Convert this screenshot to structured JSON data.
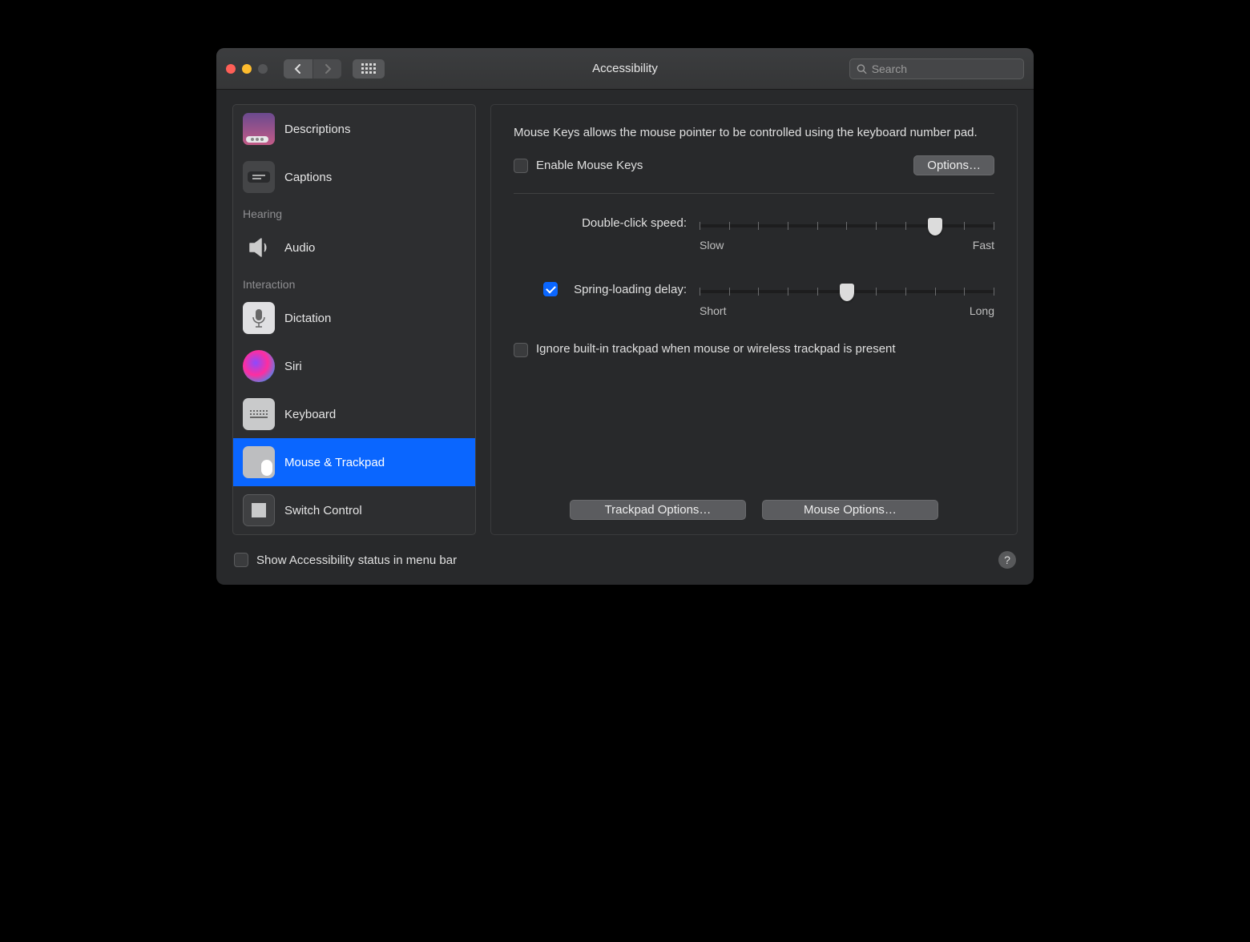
{
  "window": {
    "title": "Accessibility"
  },
  "search": {
    "placeholder": "Search"
  },
  "sidebar": {
    "items": [
      {
        "label": "Descriptions"
      },
      {
        "label": "Captions"
      }
    ],
    "hearing_header": "Hearing",
    "hearing_items": [
      {
        "label": "Audio"
      }
    ],
    "interaction_header": "Interaction",
    "interaction_items": [
      {
        "label": "Dictation"
      },
      {
        "label": "Siri"
      },
      {
        "label": "Keyboard"
      },
      {
        "label": "Mouse & Trackpad"
      },
      {
        "label": "Switch Control"
      }
    ]
  },
  "panel": {
    "intro": "Mouse Keys allows the mouse pointer to be controlled using the keyboard number pad.",
    "enable_mouse_keys_label": "Enable Mouse Keys",
    "options_btn": "Options…",
    "double_click_label": "Double-click speed:",
    "double_click_slow": "Slow",
    "double_click_fast": "Fast",
    "spring_loading_label": "Spring-loading delay:",
    "spring_loading_short": "Short",
    "spring_loading_long": "Long",
    "ignore_trackpad_label": "Ignore built-in trackpad when mouse or wireless trackpad is present",
    "trackpad_options_btn": "Trackpad Options…",
    "mouse_options_btn": "Mouse Options…"
  },
  "footer": {
    "show_status_label": "Show Accessibility status in menu bar"
  }
}
